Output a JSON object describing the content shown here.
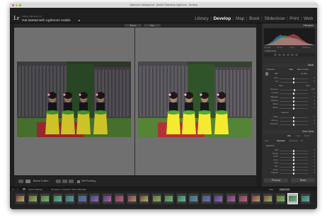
{
  "window": {
    "title": "Lightroom Catalog.lrcat - Adobe Photoshop Lightroom - Develop"
  },
  "identity": {
    "logo": "Lr",
    "catalog_label": "Adobe Lightroom CC",
    "get_started": "Get started with Lightroom mobile",
    "get_started_arrow": "▸"
  },
  "modules": [
    {
      "label": "Library",
      "active": false
    },
    {
      "label": "Develop",
      "active": true
    },
    {
      "label": "Map",
      "active": false
    },
    {
      "label": "Book",
      "active": false
    },
    {
      "label": "Slideshow",
      "active": false
    },
    {
      "label": "Print",
      "active": false
    },
    {
      "label": "Web",
      "active": false
    }
  ],
  "module_separator": "|",
  "viewer": {
    "before_label": "Before",
    "after_label": "After"
  },
  "toolbar": {
    "before_after_label": "Before & After :",
    "soft_proofing_label": "Soft Proofing"
  },
  "panel": {
    "histogram_label": "Histogram",
    "histogram_info": [
      "ISO 200",
      "24 mm",
      "f / 5.6",
      "1/125 sec"
    ],
    "original_photo_label": "Original Photo",
    "basic_label": "Basic",
    "treatment_label": "Treatment :",
    "treatment_color": "Color",
    "treatment_bw": "Black & White",
    "wb_label": "WB :",
    "wb_value": "As Shot",
    "tone_label": "Tone",
    "tone_auto": "Auto",
    "presence_label": "Presence",
    "sliders": [
      {
        "label": "Temp",
        "value": "0",
        "pos": 0.5
      },
      {
        "label": "Tint",
        "value": "0",
        "pos": 0.5
      },
      {
        "label": "Exposure",
        "value": "0.00",
        "pos": 0.52
      },
      {
        "label": "Contrast",
        "value": "0",
        "pos": 0.5
      },
      {
        "label": "Highlights",
        "value": "0",
        "pos": 0.5
      },
      {
        "label": "Shadows",
        "value": "0",
        "pos": 0.5
      },
      {
        "label": "Whites",
        "value": "0",
        "pos": 0.5
      },
      {
        "label": "Blacks",
        "value": "0",
        "pos": 0.5
      },
      {
        "label": "Clarity",
        "value": "0",
        "pos": 0.5
      },
      {
        "label": "Vibrance",
        "value": "0",
        "pos": 0.5
      },
      {
        "label": "Saturation",
        "value": "0",
        "pos": 0.5
      }
    ],
    "tone_curve_label": "Tone Curve",
    "hsl_tabs": [
      "HSL",
      "Color",
      "B & W"
    ],
    "hsl_subtabs": [
      "Hue",
      "Saturation",
      "Luminance",
      "All"
    ],
    "hsl_group_label": "Saturation",
    "hsl_rows": [
      {
        "label": "Red",
        "value": "0"
      },
      {
        "label": "Orange",
        "value": "0"
      },
      {
        "label": "Yellow",
        "value": "0"
      },
      {
        "label": "Green",
        "value": "0"
      },
      {
        "label": "Aqua",
        "value": "0"
      },
      {
        "label": "Blue",
        "value": "0"
      },
      {
        "label": "Purple",
        "value": "0"
      },
      {
        "label": "Magenta",
        "value": "0"
      }
    ],
    "previous_label": "Previous",
    "reset_label": "Reset"
  },
  "filmstrip": {
    "page1": "1",
    "page2": "2",
    "quick_collection": "Quick Collection",
    "selection_info": "10 photos / 1 selected / DSC_0001.NEF",
    "filter_label": "Filter :",
    "filter_value": "Filters Off",
    "thumb_count": 24,
    "selected_index": 22
  },
  "colors": {
    "accent": "#f2f2f2",
    "panel_bg": "#2e2e2e",
    "viewer_bg": "#707070"
  }
}
